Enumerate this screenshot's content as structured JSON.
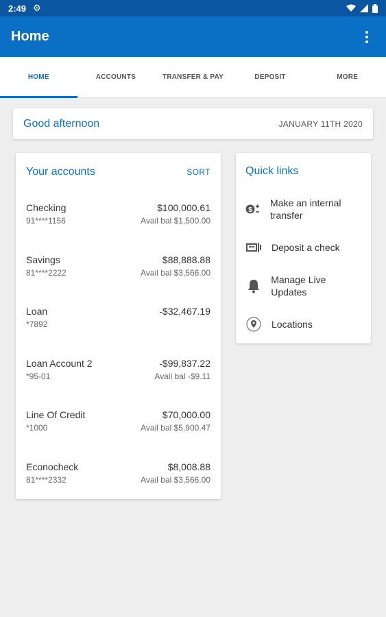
{
  "status": {
    "time": "2:49"
  },
  "app_bar": {
    "title": "Home"
  },
  "tabs": [
    {
      "label": "HOME"
    },
    {
      "label": "ACCOUNTS"
    },
    {
      "label": "TRANSFER & PAY"
    },
    {
      "label": "DEPOSIT"
    },
    {
      "label": "MORE"
    }
  ],
  "greeting": {
    "text": "Good afternoon",
    "date": "JANUARY 11TH 2020"
  },
  "accounts": {
    "title": "Your accounts",
    "sort_label": "SORT",
    "rows": [
      {
        "name": "Checking",
        "number": "91****1156",
        "balance": "$100,000.61",
        "avail": "Avail bal $1,500.00"
      },
      {
        "name": "Savings",
        "number": "81****2222",
        "balance": "$88,888.88",
        "avail": "Avail bal $3,566.00"
      },
      {
        "name": "Loan",
        "number": "*7892",
        "balance": "-$32,467.19",
        "avail": ""
      },
      {
        "name": "Loan Account 2",
        "number": "*95-01",
        "balance": "-$99,837.22",
        "avail": "Avail bal -$9.11"
      },
      {
        "name": "Line Of Credit",
        "number": "*1000",
        "balance": "$70,000.00",
        "avail": "Avail bal $5,900.47"
      },
      {
        "name": "Econocheck",
        "number": "81****2332",
        "balance": "$8,008.88",
        "avail": "Avail bal $3,566.00"
      }
    ]
  },
  "quick_links": {
    "title": "Quick links",
    "items": [
      {
        "label": "Make an internal transfer",
        "icon": "transfer-money-icon"
      },
      {
        "label": "Deposit a check",
        "icon": "check-deposit-icon"
      },
      {
        "label": "Manage Live Updates",
        "icon": "bell-icon"
      },
      {
        "label": "Locations",
        "icon": "location-pin-icon"
      }
    ]
  },
  "colors": {
    "primary": "#0a70c5",
    "status_bar": "#0b56a1",
    "background": "#eeeeee"
  }
}
